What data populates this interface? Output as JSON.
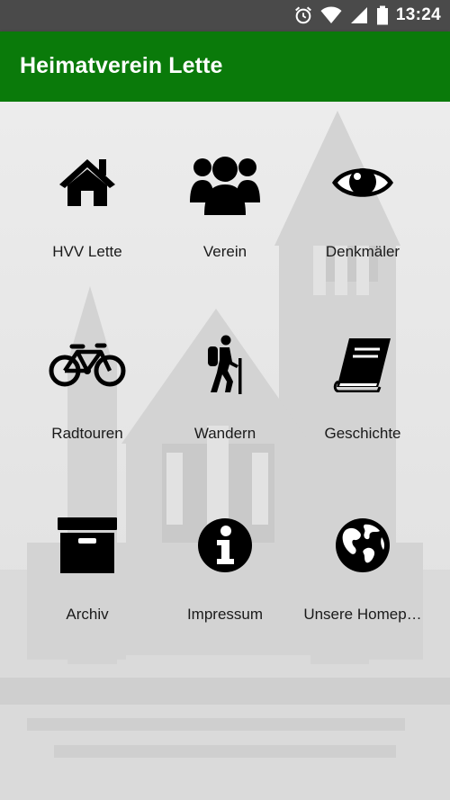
{
  "status_bar": {
    "time": "13:24",
    "icons": [
      "alarm-icon",
      "wifi-icon",
      "signal-icon",
      "battery-icon"
    ]
  },
  "app_bar": {
    "title": "Heimatverein Lette",
    "color": "#0a7a0a"
  },
  "menu": {
    "items": [
      {
        "label": "HVV Lette",
        "icon": "home-icon"
      },
      {
        "label": "Verein",
        "icon": "users-icon"
      },
      {
        "label": "Denkmäler",
        "icon": "eye-icon"
      },
      {
        "label": "Radtouren",
        "icon": "bicycle-icon"
      },
      {
        "label": "Wandern",
        "icon": "hiker-icon"
      },
      {
        "label": "Geschichte",
        "icon": "book-icon"
      },
      {
        "label": "Archiv",
        "icon": "archive-box-icon"
      },
      {
        "label": "Impressum",
        "icon": "info-icon"
      },
      {
        "label": "Unsere Homep…",
        "icon": "globe-icon"
      }
    ]
  }
}
